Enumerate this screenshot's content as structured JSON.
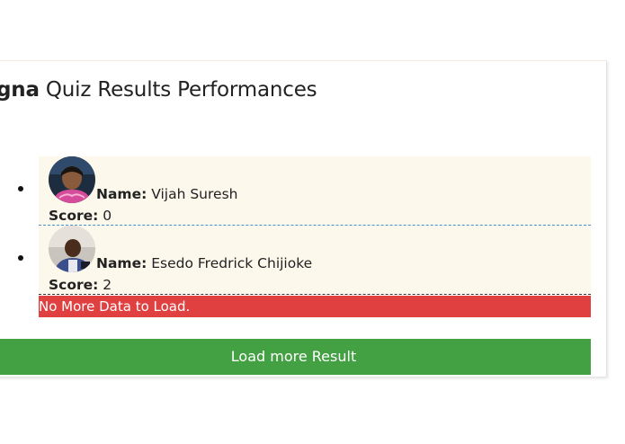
{
  "page": {
    "title_brand": "gna",
    "title_rest": " Quiz Results Performances"
  },
  "results": [
    {
      "name_label": "Name:",
      "name": " Vijah Suresh",
      "score_label": "Score:",
      "score": " 0",
      "avatar_icon": "user-photo-avatar"
    },
    {
      "name_label": "Name:",
      "name": " Esedo Fredrick Chijioke",
      "score_label": "Score:",
      "score": " 2",
      "avatar_icon": "user-photo-avatar"
    }
  ],
  "status": {
    "no_more_text": "No More Data to Load."
  },
  "actions": {
    "load_more_label": "Load more Result"
  },
  "colors": {
    "list_bg": "#fdf8ec",
    "error_bg": "#e04040",
    "button_bg": "#43a143"
  }
}
